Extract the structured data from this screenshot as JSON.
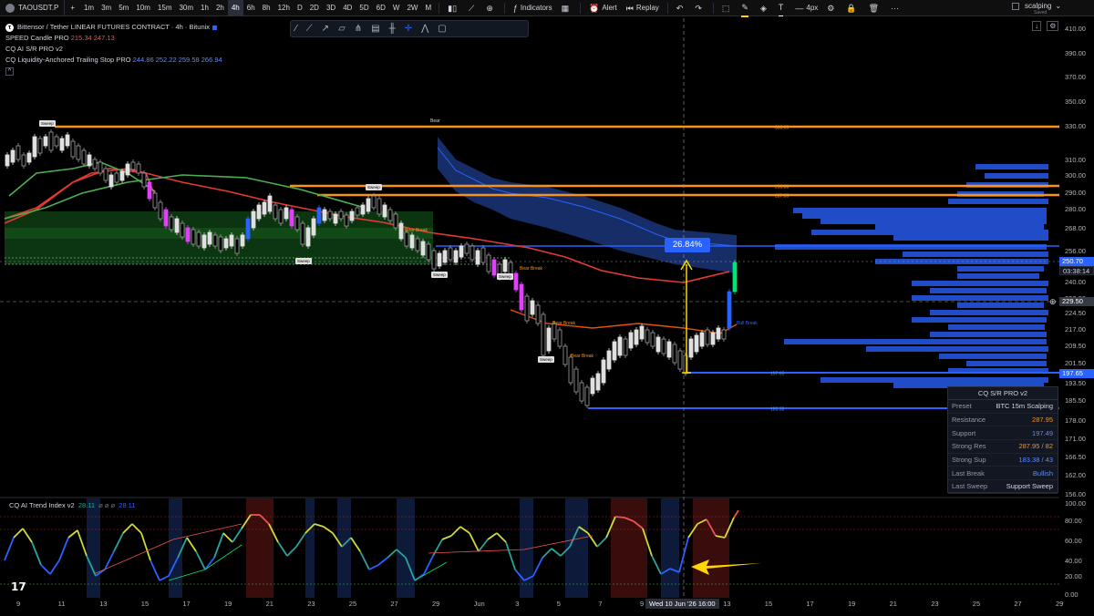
{
  "toolbar": {
    "symbol": "TAOUSDT.P",
    "timeframes": [
      "1m",
      "3m",
      "5m",
      "10m",
      "15m",
      "30m",
      "1h",
      "2h",
      "4h",
      "6h",
      "8h",
      "12h",
      "D",
      "2D",
      "3D",
      "4D",
      "5D",
      "6D",
      "W",
      "2W",
      "M"
    ],
    "active_timeframe": "4h",
    "indicators_label": "Indicators",
    "alert_label": "Alert",
    "replay_label": "Replay",
    "layout_name": "scalping",
    "layout_status": "Saved",
    "brush_size": "4px"
  },
  "legend": {
    "title": "Bittensor / Tether LINEAR FUTURES CONTRACT · 4h · Bitunix",
    "ind1_name": "SPEED Candle PRO",
    "ind1_vals": "215.34 247.13",
    "ind2_name": "CQ AI S/R PRO v2",
    "ind3_name": "CQ Liquidity-Anchored Trailing Stop PRO",
    "ind3_vals": "244.86 252.22 259.58 266.94"
  },
  "price_axis": {
    "ticks": [
      "410.00",
      "390.00",
      "370.00",
      "350.00",
      "330.00",
      "310.00",
      "300.00",
      "290.00",
      "280.00",
      "268.00",
      "256.00",
      "248.00",
      "240.00",
      "232.00",
      "224.50",
      "217.00",
      "209.50",
      "201.50",
      "193.50",
      "185.50",
      "178.00",
      "171.00",
      "166.50",
      "162.00",
      "156.00"
    ],
    "current_price": "250.70",
    "countdown": "03:38:14",
    "level_label": "229.50",
    "support_label": "197.65"
  },
  "indicator_axis": {
    "ticks": [
      "100.00",
      "80.00",
      "60.00",
      "40.00",
      "20.00",
      "0.00"
    ]
  },
  "time_axis": {
    "ticks": [
      "9",
      "11",
      "13",
      "15",
      "17",
      "19",
      "21",
      "23",
      "25",
      "27",
      "29",
      "Jun",
      "3",
      "5",
      "7",
      "9",
      "11",
      "13",
      "15",
      "17",
      "19",
      "21",
      "23",
      "25",
      "27",
      "29"
    ],
    "highlight": "Wed 10 Jun '26   16:00"
  },
  "annotations": {
    "bear": "Bear",
    "sweep": "Sweep",
    "bear_break": "Bear Break",
    "bull_break": "Bull Break",
    "percent": "26.84%",
    "level_333": "333.09",
    "level_293": "293.38",
    "level_287": "287.95",
    "level_197": "197.65",
    "level_183": "183.38"
  },
  "panel": {
    "title": "CQ S/R PRO v2",
    "rows": [
      {
        "k": "Preset",
        "v": "BTC 15m Scalping"
      },
      {
        "k": "Resistance",
        "v": "287.95"
      },
      {
        "k": "Support",
        "v": "197.49"
      },
      {
        "k": "Strong Res",
        "v": "287.95 / 82"
      },
      {
        "k": "Strong Sup",
        "v": "183.38 / 43"
      },
      {
        "k": "Last Break",
        "v": "Bullish"
      },
      {
        "k": "Last Sweep",
        "v": "Support Sweep"
      }
    ]
  },
  "indicator": {
    "name": "CQ AI Trend Index v2",
    "v1": "28.11",
    "v2": "28.11",
    "nulls": "⌀ ⌀ ⌀"
  },
  "colors": {
    "bull": "#26a69a",
    "bear_candle": "#ef5350",
    "orange": "#f7931a",
    "blue": "#2962ff",
    "green_zone": "#1b5e20",
    "magenta": "#e040fb"
  }
}
